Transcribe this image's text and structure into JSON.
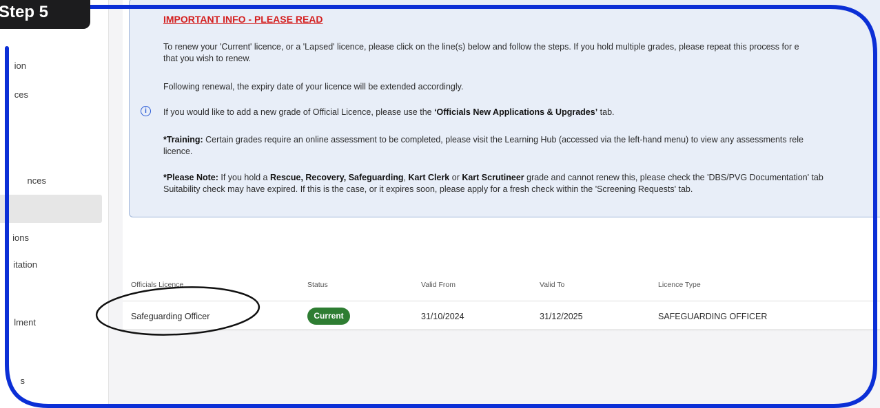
{
  "step_badge": "Step 5",
  "sidebar": {
    "items": [
      {
        "label": "ion"
      },
      {
        "label": "ces"
      },
      {
        "label": "nces"
      },
      {
        "label": ""
      },
      {
        "label": "ions"
      },
      {
        "label": "itation"
      },
      {
        "label": "lment"
      },
      {
        "label": "s"
      }
    ]
  },
  "info": {
    "title": "IMPORTANT INFO - PLEASE READ",
    "p1_line1": "To renew your 'Current' licence, or a 'Lapsed' licence, please click on the line(s) below and follow the steps. If you hold multiple grades, please repeat this process for e",
    "p1_line2": "that you wish to renew.",
    "p2": "Following renewal, the expiry date of your licence will be extended accordingly.",
    "p3_pre": "If you would like to add a new grade of Official Licence, please use the ",
    "p3_bold": "‘Officials New Applications & Upgrades’",
    "p3_post": " tab.",
    "p4_bold": "*Training:",
    "p4_line1": " Certain grades require an online assessment to be completed, please visit the Learning Hub (accessed via the left-hand menu) to view any assessments rele",
    "p4_line2": "licence.",
    "p5_bold1": "*Please Note:",
    "p5_t1": " If you hold a ",
    "p5_b2": "Rescue, Recovery, Safeguarding",
    "p5_t2": ", ",
    "p5_b3": "Kart Clerk",
    "p5_t3": " or ",
    "p5_b4": "Kart Scrutineer",
    "p5_t4": " grade and cannot renew this, please check the 'DBS/PVG Documentation' tab",
    "p5_line2": "Suitability check may have expired. If this is the case, or it expires soon, please apply for a fresh check within the 'Screening Requests' tab."
  },
  "table": {
    "headers": [
      "Officials Licence",
      "Status",
      "Valid From",
      "Valid To",
      "Licence Type"
    ],
    "rows": [
      {
        "licence": "Safeguarding Officer",
        "status": "Current",
        "valid_from": "31/10/2024",
        "valid_to": "31/12/2025",
        "licence_type": "SAFEGUARDING OFFICER"
      }
    ]
  },
  "colors": {
    "frame_blue": "#0b2fd6",
    "status_green": "#2e7d32",
    "title_red": "#d42020",
    "panel_bg": "#e8eef8"
  },
  "icons": {
    "info": "info-circle-icon"
  }
}
